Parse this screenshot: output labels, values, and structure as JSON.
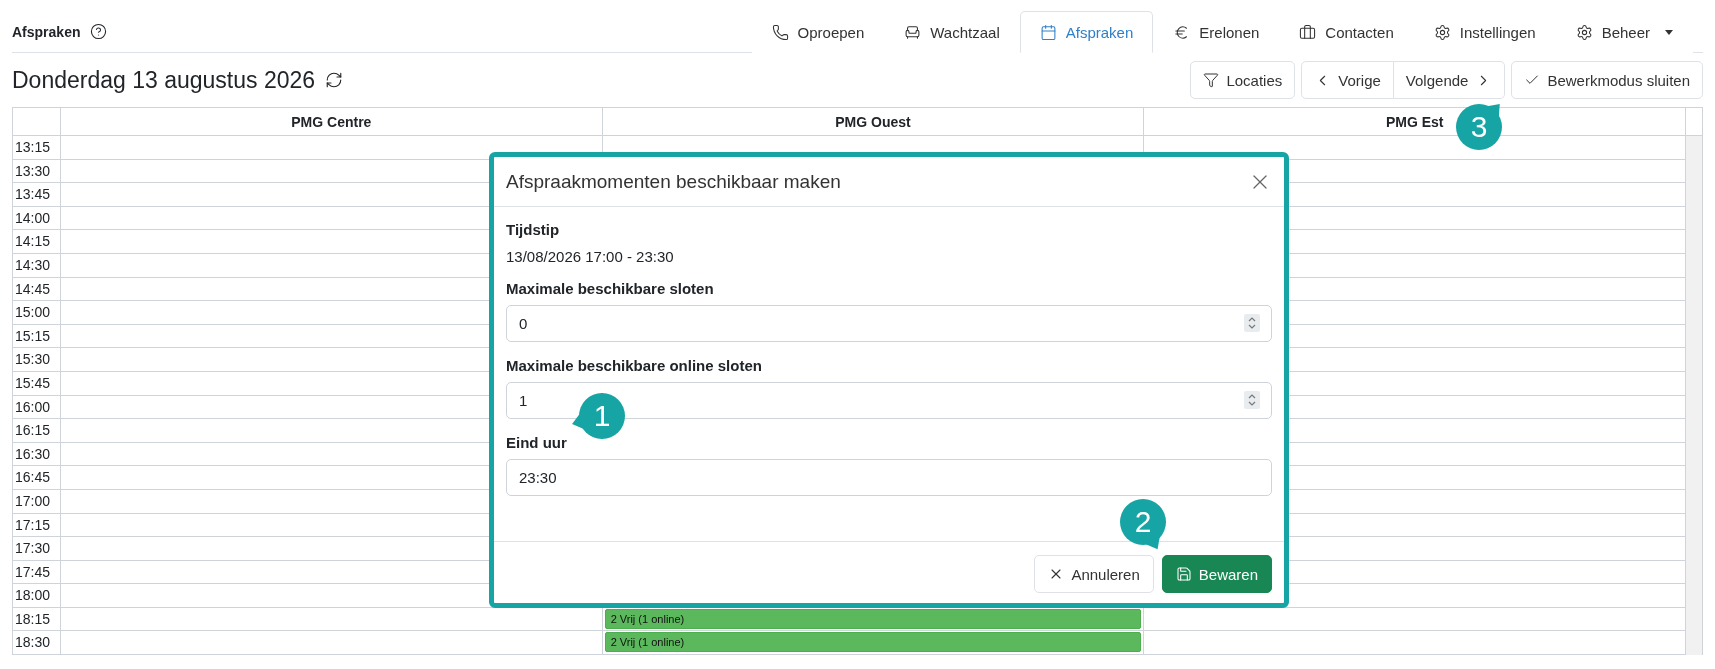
{
  "header": {
    "title": "Afspraken"
  },
  "tabs": [
    {
      "label": "Oproepen",
      "selected": false
    },
    {
      "label": "Wachtzaal",
      "selected": false
    },
    {
      "label": "Afspraken",
      "selected": true
    },
    {
      "label": "Erelonen",
      "selected": false
    },
    {
      "label": "Contacten",
      "selected": false
    },
    {
      "label": "Instellingen",
      "selected": false
    },
    {
      "label": "Beheer",
      "selected": false,
      "dropdown": true
    }
  ],
  "date_title": "Donderdag 13 augustus 2026",
  "toolbar": {
    "filter": "Locaties",
    "prev": "Vorige",
    "next": "Volgende",
    "edit_mode": "Bewerkmodus sluiten"
  },
  "calendar": {
    "columns": [
      "PMG Centre",
      "PMG Ouest",
      "PMG Est"
    ],
    "rows": [
      {
        "time": "13:15"
      },
      {
        "time": "13:30"
      },
      {
        "time": "13:45"
      },
      {
        "time": "14:00"
      },
      {
        "time": "14:15"
      },
      {
        "time": "14:30"
      },
      {
        "time": "14:45"
      },
      {
        "time": "15:00"
      },
      {
        "time": "15:15"
      },
      {
        "time": "15:30"
      },
      {
        "time": "15:45"
      },
      {
        "time": "16:00"
      },
      {
        "time": "16:15"
      },
      {
        "time": "16:30"
      },
      {
        "time": "16:45"
      },
      {
        "time": "17:00"
      },
      {
        "time": "17:15"
      },
      {
        "time": "17:30"
      },
      {
        "time": "17:45"
      },
      {
        "time": "18:00"
      },
      {
        "time": "18:15",
        "column_2": "2 Vrij (1 online)"
      },
      {
        "time": "18:30",
        "column_2": "2 Vrij (1 online)"
      }
    ]
  },
  "modal": {
    "title": "Afspraakmomenten beschikbaar maken",
    "fields": [
      {
        "kind": "static",
        "label": "Tijdstip",
        "value": "13/08/2026 17:00 - 23:30"
      },
      {
        "kind": "number",
        "label": "Maximale beschikbare sloten",
        "value": "0"
      },
      {
        "kind": "number",
        "label": "Maximale beschikbare online sloten",
        "value": "1"
      },
      {
        "kind": "text",
        "label": "Eind uur",
        "value": "23:30"
      }
    ],
    "buttons": [
      {
        "kind": "secondary",
        "label": "Annuleren"
      },
      {
        "kind": "primary",
        "label": "Bewaren"
      }
    ]
  },
  "callouts": [
    {
      "label": "1"
    },
    {
      "label": "2"
    },
    {
      "label": "3"
    }
  ]
}
